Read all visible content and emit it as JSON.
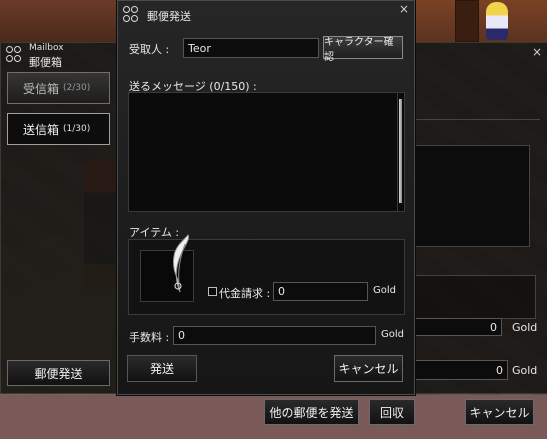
{
  "mailbox": {
    "title_en": "Mailbox",
    "title": "郵便箱",
    "inbox_label": "受信箱",
    "inbox_count": "(2/30)",
    "outbox_label": "送信箱",
    "outbox_count": "(1/30)",
    "send_mail_button": "郵便発送"
  },
  "compose": {
    "title": "郵便発送",
    "close": "×",
    "recipient_label": "受取人 :",
    "recipient_value": "Teor",
    "check_character_button": "キャラクター確認",
    "message_label": "送るメッセージ (0/150) :",
    "item_label": "アイテム :",
    "cod_label": "代金請求 :",
    "cod_value": "0",
    "cod_unit": "Gold",
    "fee_label": "手数料 :",
    "fee_value": "0",
    "fee_unit": "Gold",
    "send_button": "発送",
    "cancel_button": "キャンセル"
  },
  "mail_detail": {
    "close": "×",
    "gold_value_1": "0",
    "gold_unit_1": "Gold",
    "gold_value_2": "0",
    "gold_unit_2": "Gold",
    "forward_button": "他の郵便を発送",
    "retrieve_button": "回収",
    "cancel_button": "キャンセル"
  },
  "colors": {
    "panel": "#1c1c1c",
    "border": "#4b4b4b",
    "text": "#e6e6e6"
  }
}
